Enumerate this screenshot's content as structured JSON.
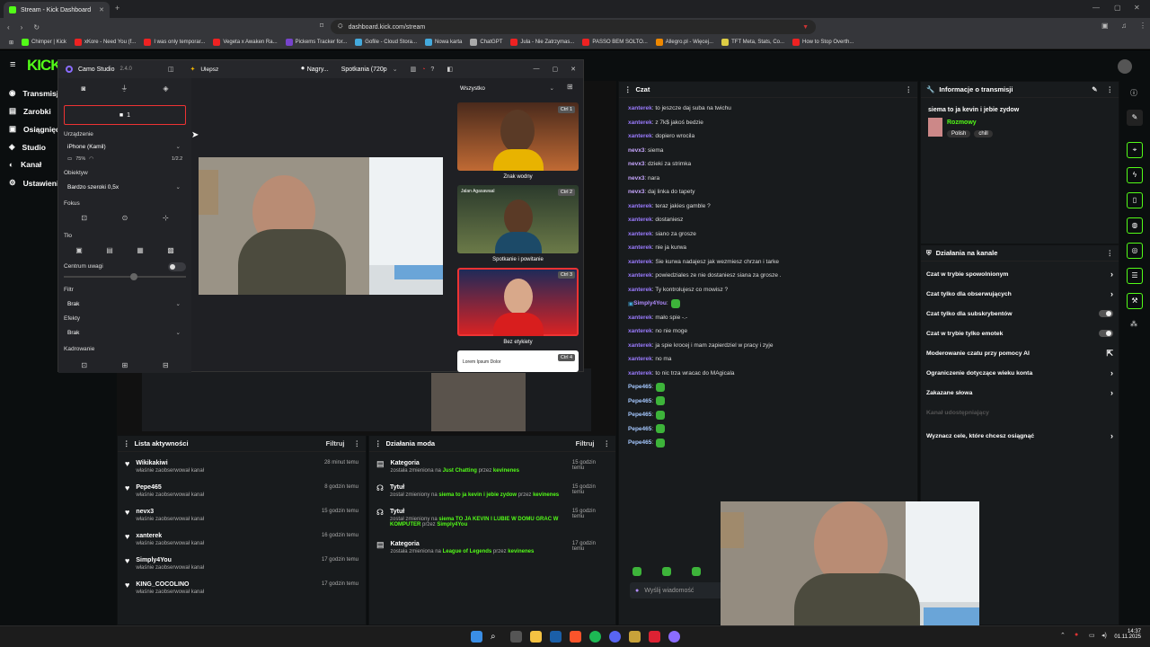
{
  "browser": {
    "tab_title": "Stream - Kick Dashboard",
    "new_tab": "+",
    "url": "dashboard.kick.com/stream",
    "bookmarks": [
      "Chimper | Kick",
      "xKore - Need You (f...",
      "I was only temporar...",
      "Vegeta x Awaken Ra...",
      "Pickems Tracker for...",
      "Gofile - Cloud Stora...",
      "Nowa karta",
      "ChatGPT",
      "Jula - Nie Zatrzymas...",
      "PASSO BEM SOLTO...",
      "Allegro.pl - Więcej...",
      "TFT Meta, Stats, Co...",
      "How to Stop Overth..."
    ]
  },
  "kick": {
    "logo": "KICK",
    "nav": [
      "Transmisja",
      "Zarobki",
      "Osiągnięcia",
      "Studio",
      "Kanał",
      "Ustawienia"
    ]
  },
  "camo": {
    "title": "Camo Studio",
    "version": "2.4.0",
    "upgrade": "Ulepsz",
    "record": "Nagry...",
    "preset": "Spotkania (720p",
    "cam_count": "1",
    "device_label": "Urządzenie",
    "device": "iPhone (Kamil)",
    "battery": "75%",
    "lens_label": "Obiektyw",
    "lens": "Bardzo szeroki 0,5x",
    "zoom": "1/2.2",
    "focus_label": "Fokus",
    "bg_label": "Tło",
    "centre_label": "Centrum uwagi",
    "filter_label": "Filtr",
    "filter": "Brak",
    "effects_label": "Efekty",
    "effects": "Brak",
    "crop_label": "Kadrowanie",
    "overlay_filter": "Wszystko",
    "thumbs": [
      {
        "caption": "Znak wodny",
        "ctrl": "Ctrl 1"
      },
      {
        "caption": "Spotkanie i powitanie",
        "ctrl": "Ctrl 2",
        "tag": "Jalan Agasawaal"
      },
      {
        "caption": "Bez etykiety",
        "ctrl": "Ctrl 3"
      },
      {
        "caption": "",
        "ctrl": "Ctrl 4",
        "tag": "Lorem Ipsum Dolor"
      }
    ]
  },
  "chat": {
    "title": "Czat",
    "placeholder": "Wyślij wiadomość",
    "messages": [
      {
        "user": "xanterek",
        "text": ": to jeszcze daj suba na twichu",
        "color": "#9b7bff"
      },
      {
        "user": "xanterek",
        "text": ": z 7k$ jakoś bedzie",
        "color": "#9b7bff"
      },
      {
        "user": "xanterek",
        "text": ": dopiero wrocila",
        "color": "#9b7bff"
      },
      {
        "user": "nevx3",
        "text": ": siema",
        "color": "#c7a6ff"
      },
      {
        "user": "nevx3",
        "text": ": dzieki za strimka",
        "color": "#c7a6ff"
      },
      {
        "user": "nevx3",
        "text": ": nara",
        "color": "#c7a6ff"
      },
      {
        "user": "nevx3",
        "text": ": daj linka do tapety",
        "color": "#c7a6ff"
      },
      {
        "user": "xanterek",
        "text": ": teraz jakies gamble ?",
        "color": "#9b7bff"
      },
      {
        "user": "xanterek",
        "text": ": dostaniesz",
        "color": "#9b7bff"
      },
      {
        "user": "xanterek",
        "text": ": siano za grosze",
        "color": "#9b7bff"
      },
      {
        "user": "xanterek",
        "text": ": nie ja kurwa",
        "color": "#9b7bff"
      },
      {
        "user": "xanterek",
        "text": ": Sie kurwa nadajesz jak wezmiesz chrzan i tarke",
        "color": "#9b7bff"
      },
      {
        "user": "xanterek",
        "text": ": powiedziales ze nie dostaniesz siana za grosze .",
        "color": "#9b7bff"
      },
      {
        "user": "xanterek",
        "text": ": Ty kontrolujesz co mowisz ?",
        "color": "#9b7bff"
      },
      {
        "user": "Simply4You",
        "text": ":",
        "color": "#b18cff"
      },
      {
        "user": "xanterek",
        "text": ": mało spie -.-",
        "color": "#9b7bff"
      },
      {
        "user": "xanterek",
        "text": ": no nie moge",
        "color": "#9b7bff"
      },
      {
        "user": "xanterek",
        "text": ": ja spie krocej i mam zapierdziel w pracy i zyje",
        "color": "#9b7bff"
      },
      {
        "user": "xanterek",
        "text": ": no ma",
        "color": "#9b7bff"
      },
      {
        "user": "xanterek",
        "text": ": to nic trza wracac do MAgicala",
        "color": "#9b7bff"
      },
      {
        "user": "Pepe465",
        "text": ":",
        "color": "#a5c8ff"
      },
      {
        "user": "Pepe465",
        "text": ":",
        "color": "#a5c8ff"
      },
      {
        "user": "Pepe465",
        "text": ":",
        "color": "#a5c8ff"
      },
      {
        "user": "Pepe465",
        "text": ":",
        "color": "#a5c8ff"
      },
      {
        "user": "Pepe465",
        "text": ":",
        "color": "#a5c8ff"
      }
    ]
  },
  "info": {
    "title": "Informacje o transmisji",
    "stream_title": "siema to ja kevin i jebie zydow",
    "category": "Rozmowy",
    "tags": [
      "Polish",
      "chill"
    ]
  },
  "mod_actions": {
    "title": "Działania na kanale",
    "items": [
      {
        "label": "Czat w trybie spowolnionym",
        "kind": "arrow"
      },
      {
        "label": "Czat tylko dla obserwujących",
        "kind": "arrow"
      },
      {
        "label": "Czat tylko dla subskrybentów",
        "kind": "toggle"
      },
      {
        "label": "Czat w trybie tylko emotek",
        "kind": "toggle"
      },
      {
        "label": "Moderowanie czatu przy pomocy AI",
        "kind": "ext"
      },
      {
        "label": "Ograniczenie dotyczące wieku konta",
        "kind": "arrow"
      },
      {
        "label": "Zakazane słowa",
        "kind": "arrow"
      },
      {
        "label": "Kanał udostępniający",
        "kind": "disabled"
      },
      {
        "label": "Wyznacz cele, które chcesz osiągnąć",
        "kind": "arrow"
      }
    ]
  },
  "activity": {
    "title": "Lista aktywności",
    "filter": "Filtruj",
    "rows": [
      {
        "name": "Wikikakiwi",
        "sub": "właśnie zaobserwował kanał",
        "time": "28 minut temu"
      },
      {
        "name": "Pepe465",
        "sub": "właśnie zaobserwował kanał",
        "time": "8 godzin temu"
      },
      {
        "name": "nevx3",
        "sub": "właśnie zaobserwował kanał",
        "time": "15 godzin temu"
      },
      {
        "name": "xanterek",
        "sub": "właśnie zaobserwował kanał",
        "time": "16 godzin temu"
      },
      {
        "name": "Simply4You",
        "sub": "właśnie zaobserwował kanał",
        "time": "17 godzin temu"
      },
      {
        "name": "KING_COCOLINO",
        "sub": "właśnie zaobserwował kanał",
        "time": "17 godzin temu"
      }
    ]
  },
  "modlog": {
    "title": "Działania moda",
    "filter": "Filtruj",
    "rows": [
      {
        "title": "Kategoria",
        "time": "15 godzin temu",
        "pre": "została zmieniona na ",
        "val": "Just Chatting",
        "mid": " przez ",
        "by": "kevinenes"
      },
      {
        "title": "Tytuł",
        "time": "15 godzin temu",
        "pre": "został zmieniony na ",
        "val": "siema to ja kevin i jebie zydow",
        "mid": " przez ",
        "by": "kevinenes"
      },
      {
        "title": "Tytuł",
        "time": "15 godzin temu",
        "pre": "został zmieniony na ",
        "val": "siema TO JA KEVIN I LUBIE W DOMU GRAC W KOMPUTER",
        "mid": " przez ",
        "by": "Simply4You"
      },
      {
        "title": "Kategoria",
        "time": "17 godzin temu",
        "pre": "została zmieniona na ",
        "val": "League of Legends",
        "mid": " przez ",
        "by": "kevinenes"
      }
    ]
  },
  "taskbar": {
    "time": "14:37",
    "date": "01.11.2025"
  },
  "colors": {
    "accent": "#53fc18",
    "panel": "#181b1d",
    "bg": "#0b0e0f"
  }
}
